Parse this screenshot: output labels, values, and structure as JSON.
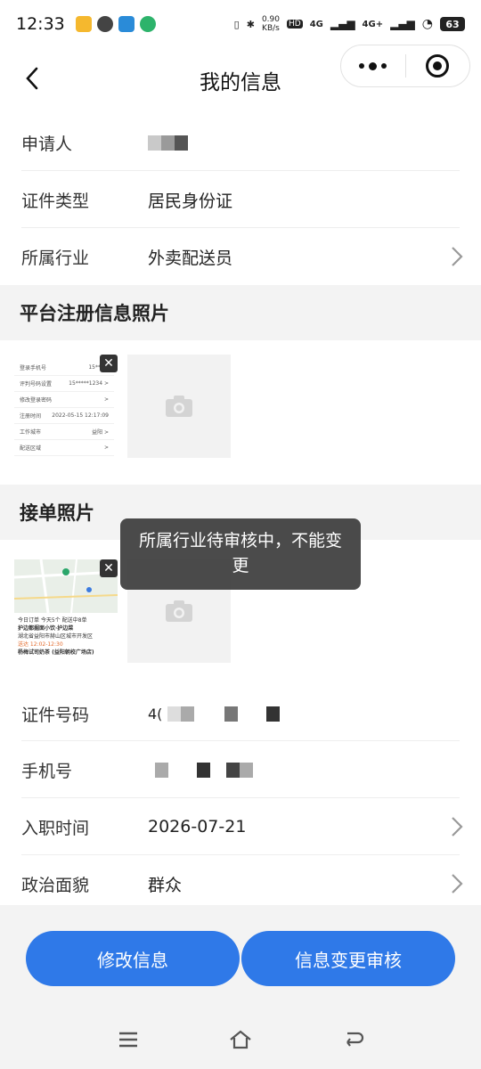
{
  "status_bar": {
    "time": "12:33",
    "net_speed_value": "0.90",
    "net_speed_unit": "KB/s",
    "hd_label": "HD",
    "net_label_1": "4G",
    "net_label_2": "4G+",
    "battery": "63"
  },
  "navbar": {
    "title": "我的信息"
  },
  "basic_rows": [
    {
      "label": "申请人",
      "value": ""
    },
    {
      "label": "证件类型",
      "value": "居民身份证"
    },
    {
      "label": "所属行业",
      "value": "外卖配送员"
    }
  ],
  "platform_section": {
    "title": "平台注册信息照片",
    "mini_rows": [
      {
        "label": "登录手机号",
        "value": "15*****"
      },
      {
        "label": "评判号码设置",
        "value": "15*****1234 >"
      },
      {
        "label": "修改登录密码",
        "value": ">"
      },
      {
        "label": "注册时间",
        "value": "2022-05-15 12:17:09"
      },
      {
        "label": "工作城市",
        "value": "益阳 >"
      },
      {
        "label": "配送区域",
        "value": ">"
      }
    ]
  },
  "order_section": {
    "title": "接单照片",
    "map_lines": [
      "今日订单  今天5个 配送中8单",
      "护边都掘面小饮·护边菜",
      "湖北省益阳市赫山区城市开发区",
      "送达 12:02-12:30",
      "杨梅试司奶茶 (益阳朝校广场店)"
    ]
  },
  "toast": {
    "text": "所属行业待审核中，不能变更"
  },
  "detail_rows": [
    {
      "label": "证件号码",
      "value_prefix": "4("
    },
    {
      "label": "手机号",
      "value_prefix": ""
    },
    {
      "label": "入职时间",
      "value": "2026-07-21"
    },
    {
      "label": "政治面貌",
      "value": "群众"
    }
  ],
  "buttons": {
    "edit": "修改信息",
    "review": "信息变更审核"
  },
  "colors": {
    "primary": "#2f79e8",
    "section_bg": "#f3f3f3",
    "toast_bg": "#3c3c3c"
  },
  "icons": {
    "back": "chevron-left-icon",
    "more": "more-dots-icon",
    "close": "target-circle-icon",
    "chevron": "chevron-right-icon",
    "camera": "camera-icon",
    "menu": "menu-icon",
    "home": "home-icon",
    "back_nav": "back-nav-icon"
  }
}
